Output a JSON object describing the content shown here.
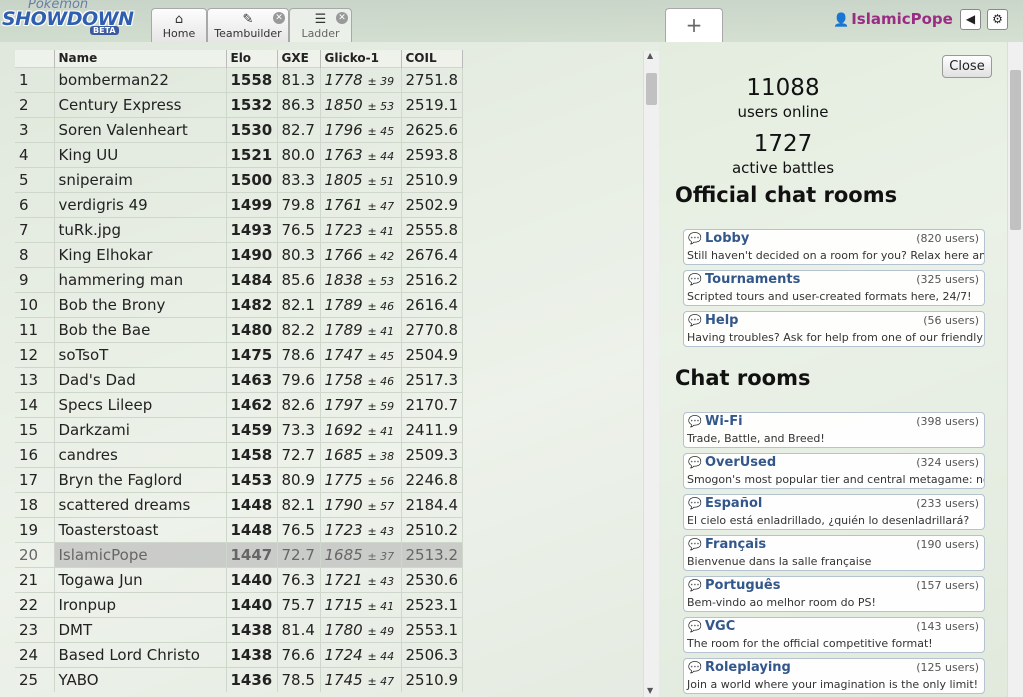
{
  "header": {
    "logo": {
      "line1": "Pokémon",
      "line2": "SHOWDOWN",
      "badge": "BETA"
    },
    "tabs": [
      {
        "label": "Home",
        "icon": "home-icon"
      },
      {
        "label": "Teambuilder",
        "icon": "edit-icon"
      },
      {
        "label": "Ladder",
        "icon": "list-icon"
      }
    ],
    "new_tab": "+",
    "username": "IslamicPope"
  },
  "ladder": {
    "columns": [
      "",
      "Name",
      "Elo",
      "GXE",
      "Glicko-1",
      "COIL"
    ],
    "rows": [
      {
        "rank": "1",
        "name": "bomberman22",
        "elo": "1558",
        "gxe": "81.3",
        "glicko": "1778",
        "dev": "± 39",
        "coil": "2751.8"
      },
      {
        "rank": "2",
        "name": "Century Express",
        "elo": "1532",
        "gxe": "86.3",
        "glicko": "1850",
        "dev": "± 53",
        "coil": "2519.1"
      },
      {
        "rank": "3",
        "name": "Soren Valenheart",
        "elo": "1530",
        "gxe": "82.7",
        "glicko": "1796",
        "dev": "± 45",
        "coil": "2625.6"
      },
      {
        "rank": "4",
        "name": "King UU",
        "elo": "1521",
        "gxe": "80.0",
        "glicko": "1763",
        "dev": "± 44",
        "coil": "2593.8"
      },
      {
        "rank": "5",
        "name": "sniperaim",
        "elo": "1500",
        "gxe": "83.3",
        "glicko": "1805",
        "dev": "± 51",
        "coil": "2510.9"
      },
      {
        "rank": "6",
        "name": "verdigris 49",
        "elo": "1499",
        "gxe": "79.8",
        "glicko": "1761",
        "dev": "± 47",
        "coil": "2502.9"
      },
      {
        "rank": "7",
        "name": "tuRk.jpg",
        "elo": "1493",
        "gxe": "76.5",
        "glicko": "1723",
        "dev": "± 41",
        "coil": "2555.8"
      },
      {
        "rank": "8",
        "name": "King Elhokar",
        "elo": "1490",
        "gxe": "80.3",
        "glicko": "1766",
        "dev": "± 42",
        "coil": "2676.4"
      },
      {
        "rank": "9",
        "name": "hammering man",
        "elo": "1484",
        "gxe": "85.6",
        "glicko": "1838",
        "dev": "± 53",
        "coil": "2516.2"
      },
      {
        "rank": "10",
        "name": "Bob the Brony",
        "elo": "1482",
        "gxe": "82.1",
        "glicko": "1789",
        "dev": "± 46",
        "coil": "2616.4"
      },
      {
        "rank": "11",
        "name": "Bob the Bae",
        "elo": "1480",
        "gxe": "82.2",
        "glicko": "1789",
        "dev": "± 41",
        "coil": "2770.8"
      },
      {
        "rank": "12",
        "name": "soTsoT",
        "elo": "1475",
        "gxe": "78.6",
        "glicko": "1747",
        "dev": "± 45",
        "coil": "2504.9"
      },
      {
        "rank": "13",
        "name": "Dad's Dad",
        "elo": "1463",
        "gxe": "79.6",
        "glicko": "1758",
        "dev": "± 46",
        "coil": "2517.3"
      },
      {
        "rank": "14",
        "name": "Specs Lileep",
        "elo": "1462",
        "gxe": "82.6",
        "glicko": "1797",
        "dev": "± 59",
        "coil": "2170.7"
      },
      {
        "rank": "15",
        "name": "Darkzami",
        "elo": "1459",
        "gxe": "73.3",
        "glicko": "1692",
        "dev": "± 41",
        "coil": "2411.9"
      },
      {
        "rank": "16",
        "name": "candres",
        "elo": "1458",
        "gxe": "72.7",
        "glicko": "1685",
        "dev": "± 38",
        "coil": "2509.3"
      },
      {
        "rank": "17",
        "name": "Bryn the Faglord",
        "elo": "1453",
        "gxe": "80.9",
        "glicko": "1775",
        "dev": "± 56",
        "coil": "2246.8"
      },
      {
        "rank": "18",
        "name": "scattered dreams",
        "elo": "1448",
        "gxe": "82.1",
        "glicko": "1790",
        "dev": "± 57",
        "coil": "2184.4"
      },
      {
        "rank": "19",
        "name": "Toasterstoast",
        "elo": "1448",
        "gxe": "76.5",
        "glicko": "1723",
        "dev": "± 43",
        "coil": "2510.2"
      },
      {
        "rank": "20",
        "name": "IslamicPope",
        "elo": "1447",
        "gxe": "72.7",
        "glicko": "1685",
        "dev": "± 37",
        "coil": "2513.2"
      },
      {
        "rank": "21",
        "name": "Togawa Jun",
        "elo": "1440",
        "gxe": "76.3",
        "glicko": "1721",
        "dev": "± 43",
        "coil": "2530.6"
      },
      {
        "rank": "22",
        "name": "Ironpup",
        "elo": "1440",
        "gxe": "75.7",
        "glicko": "1715",
        "dev": "± 41",
        "coil": "2523.1"
      },
      {
        "rank": "23",
        "name": "DMT",
        "elo": "1438",
        "gxe": "81.4",
        "glicko": "1780",
        "dev": "± 49",
        "coil": "2553.1"
      },
      {
        "rank": "24",
        "name": "Based Lord Christo",
        "elo": "1438",
        "gxe": "76.6",
        "glicko": "1724",
        "dev": "± 44",
        "coil": "2506.3"
      },
      {
        "rank": "25",
        "name": "YABO",
        "elo": "1436",
        "gxe": "78.5",
        "glicko": "1745",
        "dev": "± 47",
        "coil": "2510.9"
      }
    ],
    "highlight_rank": "20"
  },
  "rooms_panel": {
    "close_label": "Close",
    "users_online": "11088",
    "users_online_label": "users online",
    "active_battles": "1727",
    "active_battles_label": "active battles",
    "official_title": "Official chat rooms",
    "chat_title": "Chat rooms",
    "official_rooms": [
      {
        "name": "Lobby",
        "users": "(820 users)",
        "desc": "Still haven't decided on a room for you? Relax here amidst the chaos."
      },
      {
        "name": "Tournaments",
        "users": "(325 users)",
        "desc": "Scripted tours and user-created formats here, 24/7!"
      },
      {
        "name": "Help",
        "users": "(56 users)",
        "desc": "Having troubles? Ask for help from one of our friendly staff."
      }
    ],
    "chat_rooms": [
      {
        "name": "Wi-Fi",
        "users": "(398 users)",
        "desc": "Trade, Battle, and Breed!"
      },
      {
        "name": "OverUsed",
        "users": "(324 users)",
        "desc": "Smogon's most popular tier and central metagame: now with more discussion"
      },
      {
        "name": "Español",
        "users": "(233 users)",
        "desc": "El cielo está enladrillado, ¿quién lo desenladrillará?"
      },
      {
        "name": "Français",
        "users": "(190 users)",
        "desc": "Bienvenue dans la salle française"
      },
      {
        "name": "Português",
        "users": "(157 users)",
        "desc": "Bem-vindo ao melhor room do PS!"
      },
      {
        "name": "VGC",
        "users": "(143 users)",
        "desc": "The room for the official competitive format!"
      },
      {
        "name": "Roleplaying",
        "users": "(125 users)",
        "desc": "Join a world where your imagination is the only limit!"
      }
    ]
  }
}
